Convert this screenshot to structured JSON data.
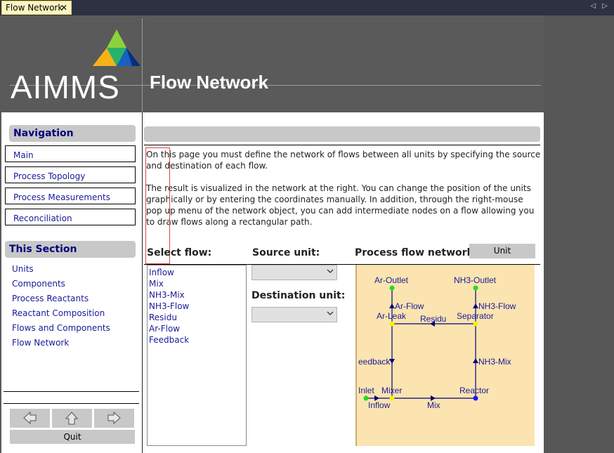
{
  "tab": {
    "title": "Flow Network",
    "close": "✕",
    "nav_arrows": "◁ ▷"
  },
  "header": {
    "logo_text": "AIMMS",
    "title": "Flow Network"
  },
  "navigation": {
    "heading": "Navigation",
    "items": [
      {
        "label": "Main"
      },
      {
        "label": "Process Topology"
      },
      {
        "label": "Process Measurements"
      },
      {
        "label": "Reconciliation"
      }
    ]
  },
  "this_section": {
    "heading": "This Section",
    "items": [
      {
        "label": "Units"
      },
      {
        "label": "Components"
      },
      {
        "label": "Process Reactants"
      },
      {
        "label": "Reactant Composition"
      },
      {
        "label": "Flows and Components"
      },
      {
        "label": "Flow Network"
      }
    ]
  },
  "footer": {
    "quit_label": "Quit"
  },
  "content": {
    "paragraph1": "On this page you must define the network of flows between all units by specifying the source and destination of each flow.",
    "paragraph2": "The result is visualized in the network at the right. You can change the position of the units graphically or by entering the coordinates manually. In addition, through the right-mouse pop up menu of the network object, you can add intermediate nodes on a flow allowing you to draw flows along a rectangular path.",
    "select_flow_label": "Select flow:",
    "source_unit_label": "Source unit:",
    "destination_unit_label": "Destination unit:",
    "network_label": "Process flow network:",
    "unit_button": "Unit",
    "flows": [
      "Inflow",
      "Mix",
      "NH3-Mix",
      "NH3-Flow",
      "Residu",
      "Ar-Flow",
      "Feedback"
    ],
    "source_unit_value": "",
    "destination_unit_value": ""
  },
  "network": {
    "node_labels": {
      "ar_outlet": "Ar-Outlet",
      "nh3_outlet": "NH3-Outlet",
      "ar_leak": "Ar-Leak",
      "separator": "Separator",
      "inlet": "Inlet",
      "mixer": "Mixer",
      "reactor": "Reactor"
    },
    "flow_labels": {
      "ar_flow": "Ar-Flow",
      "nh3_flow": "NH3-Flow",
      "residu": "Residu",
      "feedback": "eedback",
      "nh3_mix": "NH3-Mix",
      "inflow": "Inflow",
      "mix": "Mix"
    },
    "colors": {
      "edge": "#00007a",
      "source_sink": "#22dd22",
      "intermediate": "#f2f200",
      "reactor": "#1a1aff",
      "background": "#fce4b0"
    }
  }
}
